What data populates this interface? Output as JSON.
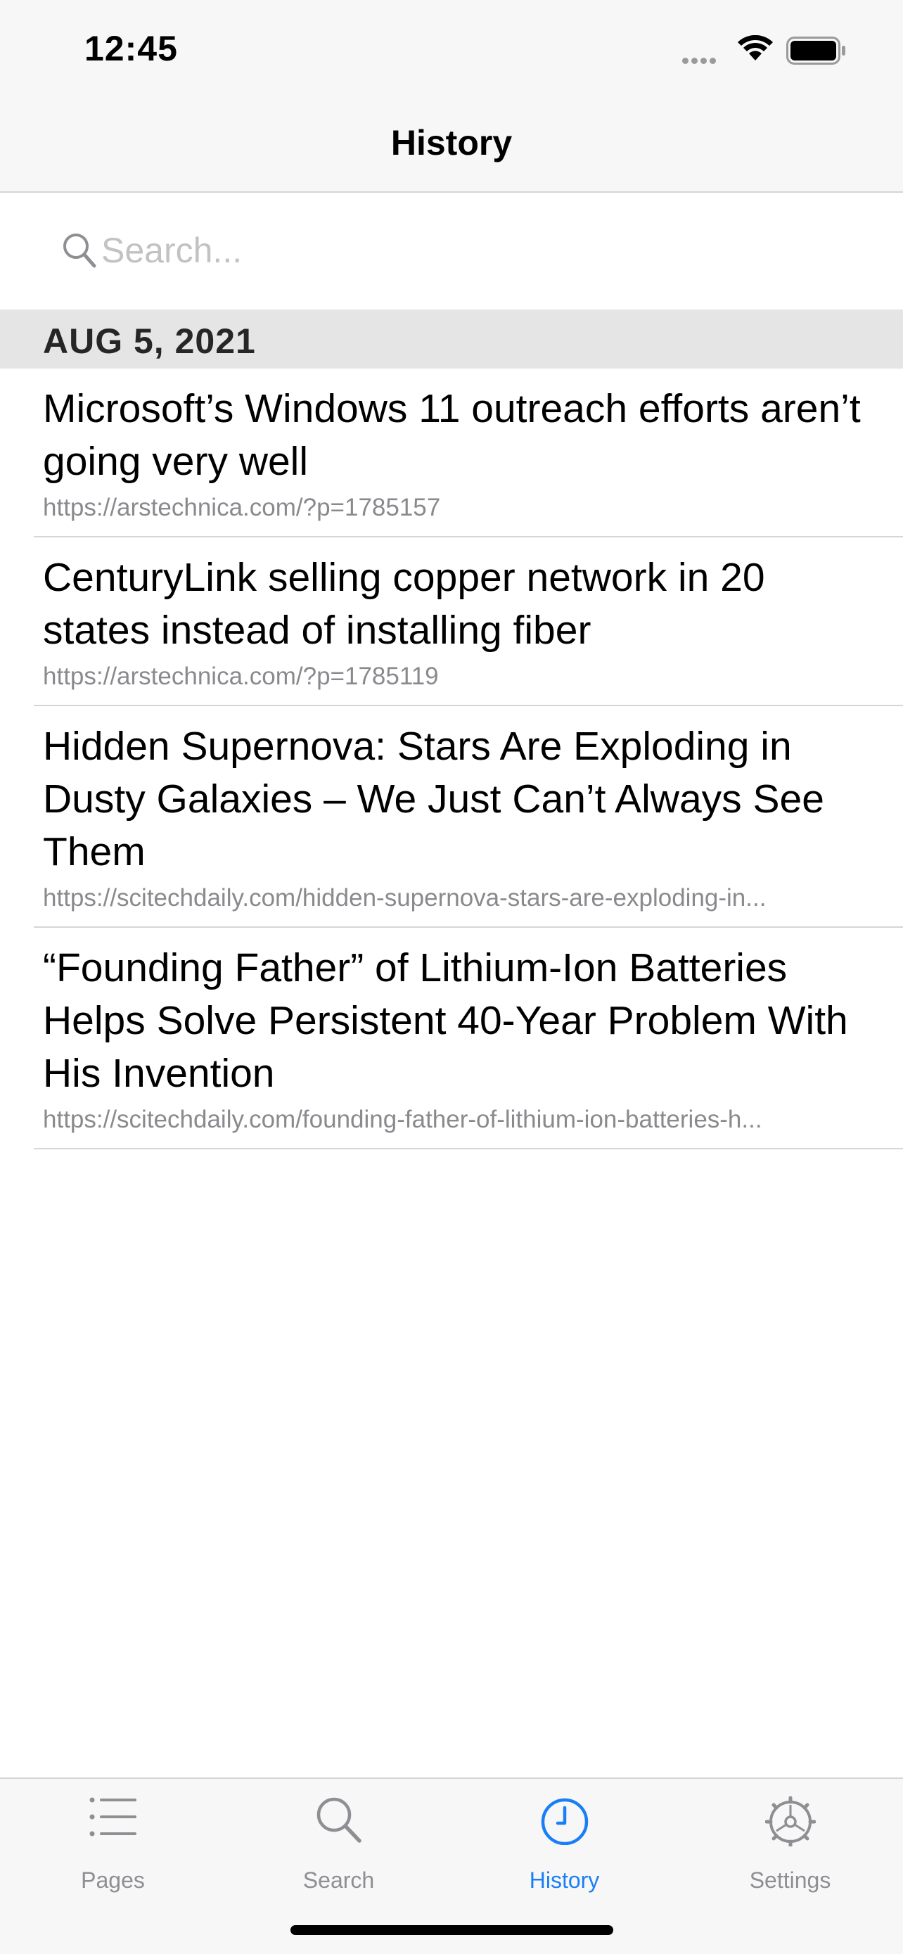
{
  "status_bar": {
    "time": "12:45"
  },
  "nav": {
    "title": "History"
  },
  "search": {
    "placeholder": "Search..."
  },
  "section": {
    "date": "AUG 5, 2021"
  },
  "items": [
    {
      "title": "Microsoft’s Windows 11 outreach efforts aren’t going very well",
      "url": "https://arstechnica.com/?p=1785157"
    },
    {
      "title": "CenturyLink selling copper network in 20 states instead of installing fiber",
      "url": "https://arstechnica.com/?p=1785119"
    },
    {
      "title": "Hidden Supernova: Stars Are Exploding in Dusty Galaxies – We Just Can’t Always See Them",
      "url": "https://scitechdaily.com/hidden-supernova-stars-are-exploding-in..."
    },
    {
      "title": "“Founding Father” of Lithium-Ion Batteries Helps Solve Persistent 40-Year Problem With His Invention",
      "url": "https://scitechdaily.com/founding-father-of-lithium-ion-batteries-h..."
    }
  ],
  "tabs": [
    {
      "label": "Pages",
      "icon": "list-icon",
      "active": false
    },
    {
      "label": "Search",
      "icon": "search-icon",
      "active": false
    },
    {
      "label": "History",
      "icon": "clock-icon",
      "active": true
    },
    {
      "label": "Settings",
      "icon": "gear-icon",
      "active": false
    }
  ],
  "colors": {
    "accent": "#1a7ff6",
    "inactive": "#8e8e93",
    "bar_bg": "#f7f7f7",
    "section_bg": "#e5e5e5"
  }
}
